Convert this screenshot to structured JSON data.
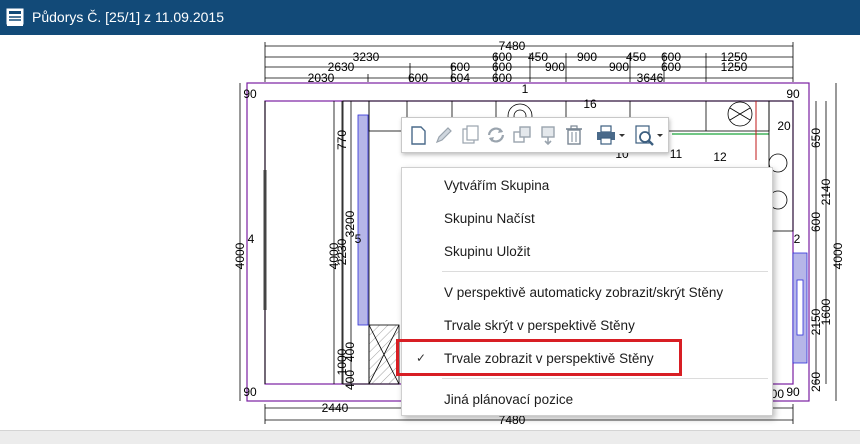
{
  "window": {
    "title": "Půdorys Č. [25/1] z 11.09.2015",
    "icon": "floorplan-document-icon"
  },
  "plan": {
    "dimensions_top": {
      "row1": [
        "7480"
      ],
      "row2": [
        "3230",
        "600",
        "450",
        "900",
        "450",
        "600",
        "1250"
      ],
      "row3": [
        "2630",
        "600",
        "600",
        "900",
        "900",
        "600",
        "1250"
      ],
      "row4": [
        "2030",
        "600",
        "604",
        "600",
        "3646"
      ]
    },
    "dimensions_bottom": [
      "2440",
      "7480",
      "300"
    ],
    "dimensions_left": [
      "4000",
      "4000",
      "2230",
      "3200",
      "770",
      "1000",
      "400",
      "400"
    ],
    "dimensions_right": [
      "650",
      "2140",
      "600",
      "4000",
      "2150",
      "1600",
      "260",
      "20"
    ],
    "corner_labels": [
      "90",
      "90",
      "90",
      "90"
    ],
    "wall_labels": [
      "1",
      "2",
      "4",
      "5"
    ],
    "cabinet_labels": [
      "10",
      "11",
      "12",
      "16",
      "20"
    ],
    "colors": {
      "walls": "#7a1fa2",
      "cabinet_highlight": "#2f2fd8",
      "green_line": "#1aa33a",
      "red_line": "#c01818"
    }
  },
  "toolbar": {
    "buttons": [
      "new-icon",
      "edit-icon",
      "copy-icon",
      "rotate-icon",
      "duplicate-icon",
      "move-icon",
      "delete-icon",
      "print-icon",
      "preview-icon"
    ]
  },
  "context_menu": {
    "items": [
      {
        "label": "Vytvářím Skupina",
        "checked": false
      },
      {
        "label": "Skupinu Načíst",
        "checked": false
      },
      {
        "label": "Skupinu Uložit",
        "checked": false
      },
      {
        "label": "V perspektivě automaticky zobrazit/skrýt Stěny",
        "checked": false
      },
      {
        "label": "Trvale skrýt v perspektivě Stěny",
        "checked": false
      },
      {
        "label": "Trvale zobrazit v perspektivě Stěny",
        "checked": true
      },
      {
        "label": "Jiná plánovací pozice",
        "checked": false
      }
    ],
    "check_glyph": "✓",
    "highlight_color": "#d81e24"
  }
}
